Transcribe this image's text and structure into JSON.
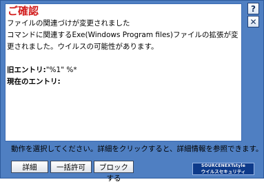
{
  "dialog": {
    "title": "ご確認",
    "lines": [
      "ファイルの関連づけが変更されました",
      "コマンドに関連するExe(Windows Program files)ファイルの拡張が変",
      "更されました。ウイルスの可能性があります。"
    ],
    "old_entry_label": "旧エントリ:",
    "old_entry_value": "\"%1\" %*",
    "current_entry_label": "現在のエントリ:",
    "current_entry_value": ""
  },
  "side_buttons": {
    "help": "?",
    "close": "✕"
  },
  "instruction": "動作を選択してください。詳細をクリックすると、詳細情報を参照できます。",
  "buttons": {
    "details": "詳細",
    "allow_all": "一括許可",
    "block": "ブロックする"
  },
  "logo": {
    "line1": "SOURCENEXTstyle",
    "line2": "ウイルスセキュリティ"
  }
}
